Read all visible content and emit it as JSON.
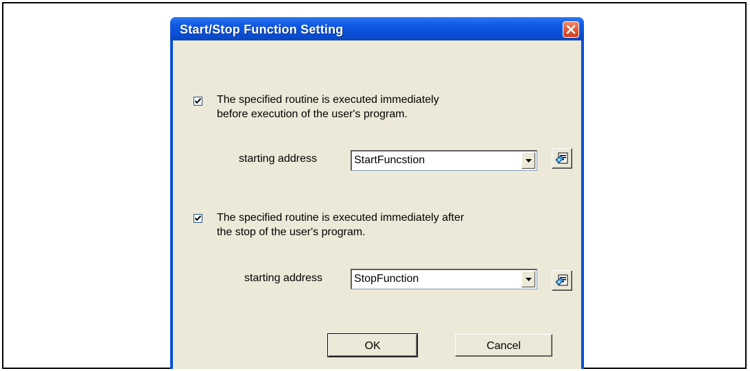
{
  "dialog": {
    "title": "Start/Stop Function Setting"
  },
  "start": {
    "checked": true,
    "line1": "The specified routine is executed immediately",
    "line2": "before execution of the user's program.",
    "address_label": "starting address",
    "address_value": "StartFuncstion"
  },
  "stop": {
    "checked": true,
    "line1": "The specified routine is executed immediately after",
    "line2": "the stop of the user's  program.",
    "address_label": "starting address",
    "address_value": "StopFunction"
  },
  "buttons": {
    "ok_label": "OK",
    "cancel_label": "Cancel"
  },
  "icons": {
    "close": "close-icon",
    "checkmark": "checkmark-icon",
    "dropdown": "dropdown-arrow-icon",
    "browse": "browse-symbol-icon"
  }
}
